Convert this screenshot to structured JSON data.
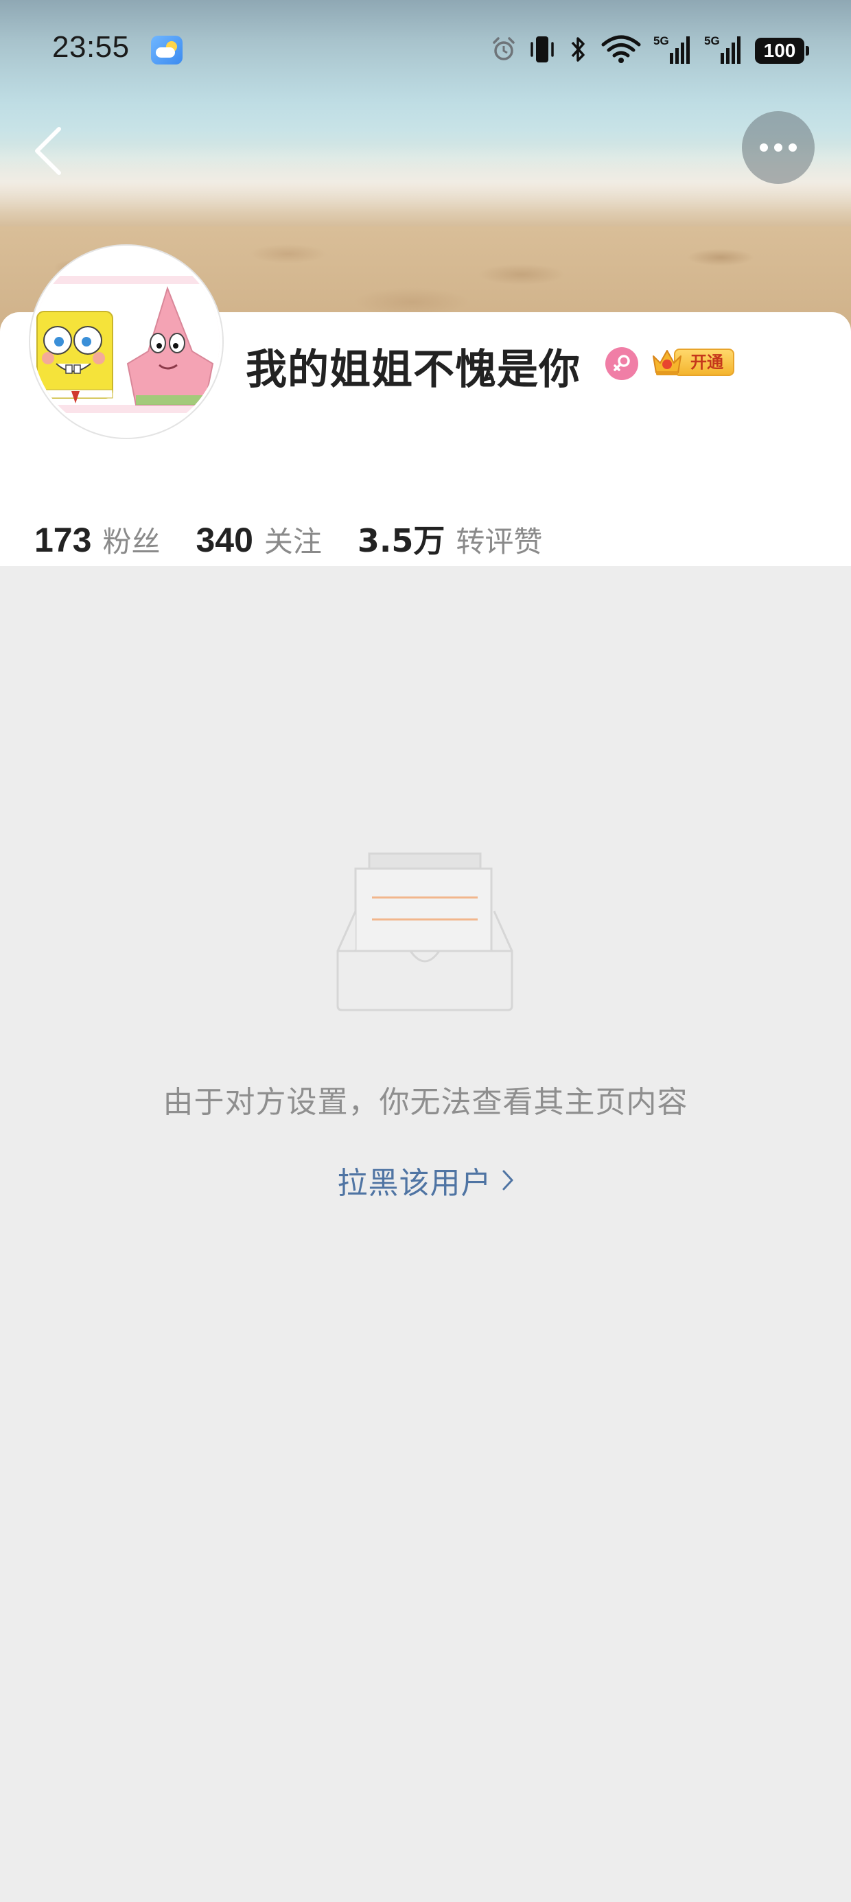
{
  "status_bar": {
    "time": "23:55",
    "battery": "100",
    "signal_label_1": "5G",
    "signal_label_2": "5G",
    "icons": [
      "weather-icon",
      "alarm-icon",
      "vibrate-icon",
      "bluetooth-icon",
      "wifi-icon",
      "signal-5g-icon",
      "signal-5g-icon",
      "battery-icon"
    ]
  },
  "nav": {
    "back_icon": "chevron-left-icon",
    "more_icon": "more-horizontal-icon"
  },
  "profile": {
    "username": "我的姐姐不愧是你",
    "gender_icon": "female-icon",
    "vip_label": "开通",
    "vip_icon": "crown-icon"
  },
  "stats": [
    {
      "value": "173",
      "label": "粉丝"
    },
    {
      "value": "340",
      "label": "关注"
    },
    {
      "value": "3.5万",
      "label": "转评赞"
    }
  ],
  "empty_state": {
    "illustration_icon": "empty-inbox-icon",
    "message": "由于对方设置，你无法查看其主页内容",
    "action_label": "拉黑该用户"
  },
  "colors": {
    "page_background": "#EDEDED",
    "card_background": "#FFFFFF",
    "link": "#4F74A3",
    "muted_text": "#8E8E8E",
    "gender_pink": "#F07EA6",
    "vip_gold": "#F4B52F"
  }
}
